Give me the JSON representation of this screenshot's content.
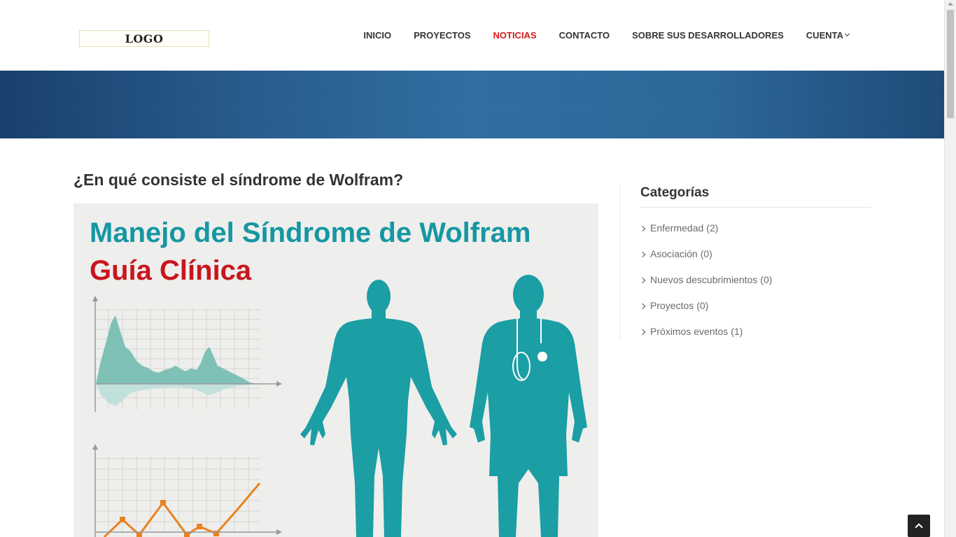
{
  "header": {
    "logo_text": "LOGO",
    "nav": [
      {
        "label": "INICIO",
        "active": false
      },
      {
        "label": "PROYECTOS",
        "active": false
      },
      {
        "label": "NOTICIAS",
        "active": true
      },
      {
        "label": "CONTACTO",
        "active": false
      },
      {
        "label": "SOBRE SUS DESARROLLADORES",
        "active": false
      },
      {
        "label": "CUENTA",
        "active": false,
        "dropdown": true
      }
    ]
  },
  "article": {
    "title": "¿En qué consiste el síndrome de Wolfram?",
    "figure": {
      "title_line1": "Manejo del Síndrome de Wolfram",
      "title_line2": "Guía Clínica",
      "colors": {
        "teal": "#1597a3",
        "red": "#c9161e",
        "orange": "#e9821e"
      }
    }
  },
  "sidebar": {
    "title": "Categorías",
    "categories": [
      {
        "label": "Enfermedad",
        "count": "(2)"
      },
      {
        "label": "Asociación",
        "count": "(0)"
      },
      {
        "label": "Nuevos descubrimientos",
        "count": "(0)"
      },
      {
        "label": "Proyectos",
        "count": "(0)"
      },
      {
        "label": "Próximos eventos",
        "count": "(1)"
      }
    ]
  },
  "colors": {
    "accent": "#d71a1a",
    "banner": "#2c679b"
  }
}
